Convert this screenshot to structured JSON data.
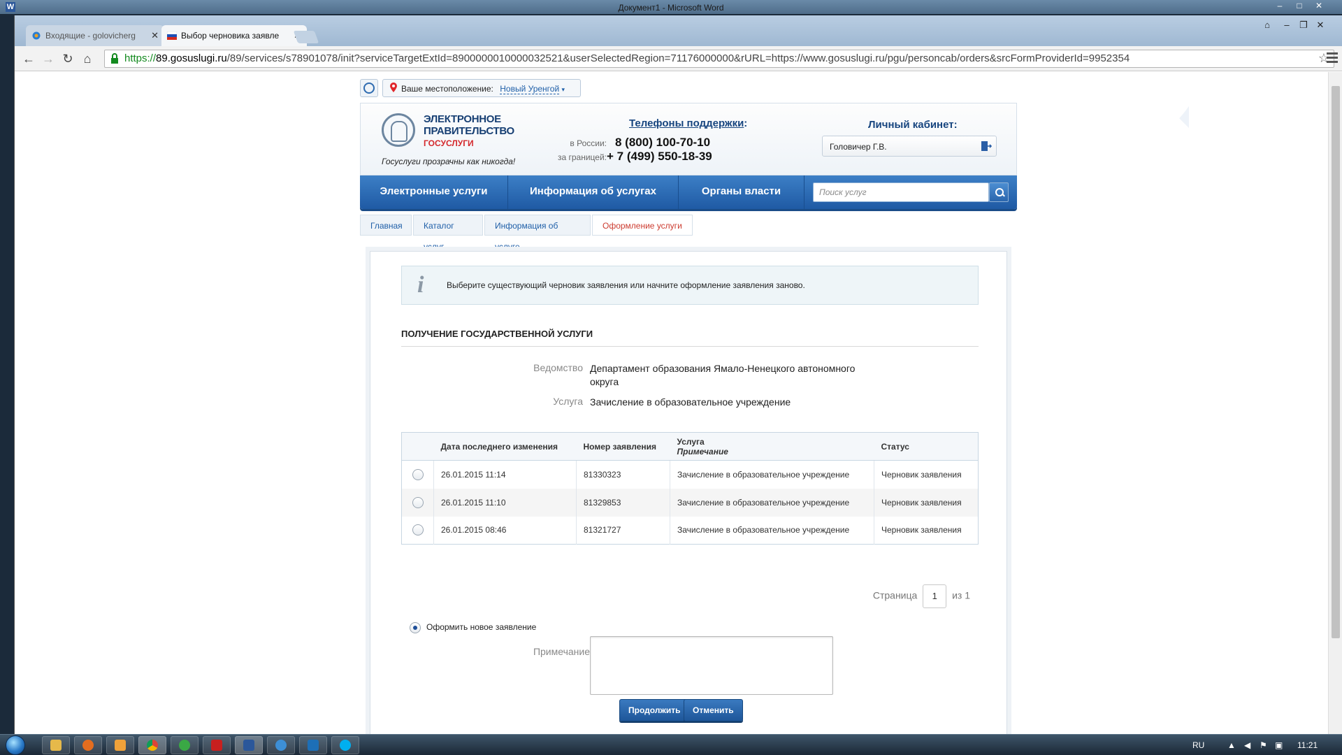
{
  "os": {
    "window_title": "Документ1 - Microsoft Word",
    "word_icon": "W",
    "clock": "11:21",
    "language": "RU",
    "taskbar_icons": [
      "explorer-icon",
      "firefox-icon",
      "media-player-icon",
      "chrome-icon",
      "green-app-icon",
      "acrobat-icon",
      "word-icon",
      "mail-icon",
      "lync-icon",
      "skype-icon"
    ]
  },
  "browser": {
    "tabs": [
      {
        "title": "Входящие - golovicherg"
      },
      {
        "title": "Выбор черновика заявле"
      }
    ],
    "url_scheme": "https://",
    "url_host": "89.gosuslugi.ru",
    "url_path": "/89/services/s78901078/init?serviceTargetExtId=8900000010000032521&userSelectedRegion=71176000000&rURL=https://www.gosuslugi.ru/pgu/personcab/orders&srcFormProviderId=9952354"
  },
  "location": {
    "label": "Ваше местоположение:",
    "city": "Новый Уренгой"
  },
  "header": {
    "logo_line1": "ЭЛЕКТРОННОЕ",
    "logo_line2": "ПРАВИТЕЛЬСТВО",
    "logo_line3": "ГОСУСЛУГИ",
    "slogan": "Госуслуги прозрачны как никогда!",
    "phones_title": "Телефоны поддержки",
    "phones_colon": ":",
    "phone_russia_label": "в России:",
    "phone_russia": "8 (800) 100-70-10",
    "phone_abroad_label": "за границей:",
    "phone_abroad": "+ 7 (499) 550-18-39",
    "cabinet_title": "Личный кабинет:",
    "cabinet_user": "Головичер Г.В."
  },
  "nav": {
    "items": [
      "Электронные услуги",
      "Информация об услугах",
      "Органы власти"
    ],
    "search_placeholder": "Поиск услуг"
  },
  "breadcrumbs": [
    "Главная",
    "Каталог услуг",
    "Информация об услуге",
    "Оформление услуги"
  ],
  "info_message": "Выберите существующий черновик заявления или начните оформление заявления заново.",
  "section_title": "ПОЛУЧЕНИЕ ГОСУДАРСТВЕННОЙ УСЛУГИ",
  "details": {
    "dept_label": "Ведомство",
    "dept_value": "Департамент образования Ямало-Ненецкого автономного округа",
    "service_label": "Услуга",
    "service_value": "Зачисление в образовательное учреждение"
  },
  "table": {
    "col_date": "Дата последнего изменения",
    "col_number": "Номер заявления",
    "col_service": "Услуга",
    "col_note": "Примечание",
    "col_status": "Статус",
    "rows": [
      {
        "date": "26.01.2015 11:14",
        "number": "81330323",
        "service": "Зачисление в образовательное учреждение",
        "status": "Черновик заявления"
      },
      {
        "date": "26.01.2015 11:10",
        "number": "81329853",
        "service": "Зачисление в образовательное учреждение",
        "status": "Черновик заявления"
      },
      {
        "date": "26.01.2015 08:46",
        "number": "81321727",
        "service": "Зачисление в образовательное учреждение",
        "status": "Черновик заявления"
      }
    ]
  },
  "pager": {
    "label": "Страница",
    "current": "1",
    "of_label": "из 1"
  },
  "new_application": {
    "label": "Оформить новое заявление",
    "note_label": "Примечание",
    "note_value": ""
  },
  "buttons": {
    "continue": "Продолжить",
    "cancel": "Отменить"
  },
  "colors": {
    "brand_blue": "#1f5aa4",
    "accent_red": "#cc3b2f"
  }
}
